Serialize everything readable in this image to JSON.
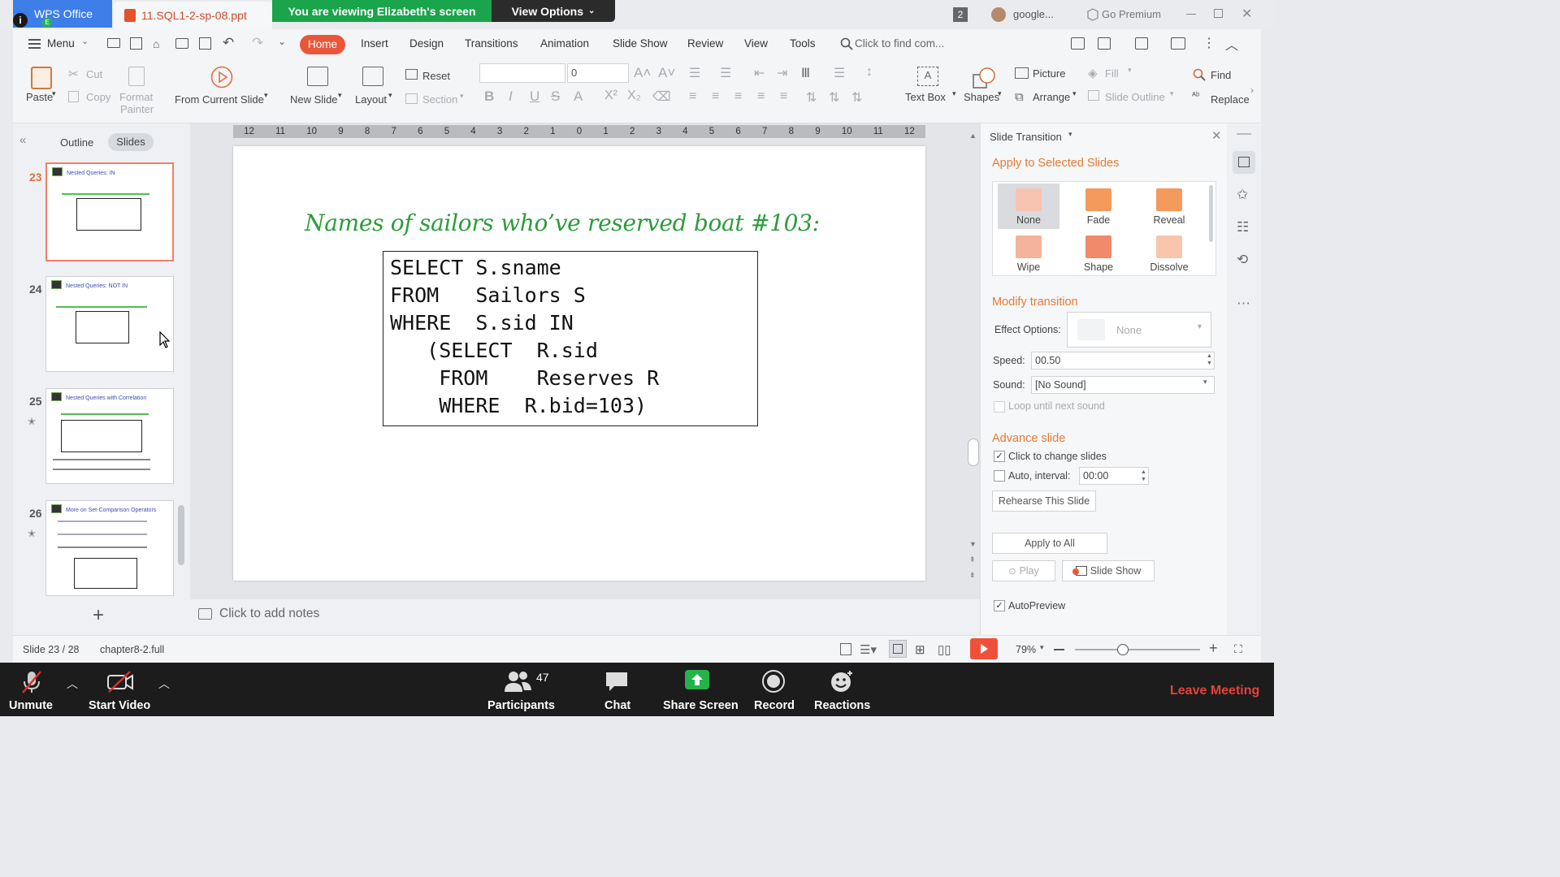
{
  "window": {
    "app_tab": "WPS Office",
    "file_tab": "11.SQL1-2-sp-08.ppt",
    "share_banner": "You are viewing Elizabeth's screen",
    "view_options": "View Options",
    "badge_count": "2",
    "account": "google...",
    "premium": "Go Premium"
  },
  "menubar": {
    "menu_label": "Menu",
    "tabs": [
      "Home",
      "Insert",
      "Design",
      "Transitions",
      "Animation",
      "Slide Show",
      "Review",
      "View",
      "Tools"
    ],
    "search_placeholder": "Click to find com..."
  },
  "ribbon": {
    "paste": "Paste",
    "cut": "Cut",
    "copy": "Copy",
    "format_painter_1": "Format",
    "format_painter_2": "Painter",
    "from_current_slide": "From Current Slide",
    "new_slide": "New Slide",
    "layout": "Layout",
    "reset": "Reset",
    "section": "Section",
    "font_size": "0",
    "text_box": "Text Box",
    "shapes": "Shapes",
    "picture": "Picture",
    "arrange": "Arrange",
    "fill": "Fill",
    "slide_outline": "Slide Outline",
    "find": "Find",
    "replace": "Replace"
  },
  "left_panel": {
    "outline_tab": "Outline",
    "slides_tab": "Slides",
    "thumbnails": [
      {
        "num": "23",
        "title": "Nested Queries: IN",
        "selected": true,
        "starred": false
      },
      {
        "num": "24",
        "title": "Nested Queries: NOT IN",
        "selected": false,
        "starred": false
      },
      {
        "num": "25",
        "title": "Nested Queries with Correlation",
        "selected": false,
        "starred": true
      },
      {
        "num": "26",
        "title": "More on Set-Comparison Operators",
        "selected": false,
        "starred": true
      }
    ]
  },
  "slide": {
    "ruler": [
      "12",
      "11",
      "10",
      "9",
      "8",
      "7",
      "6",
      "5",
      "4",
      "3",
      "2",
      "1",
      "0",
      "1",
      "2",
      "3",
      "4",
      "5",
      "6",
      "7",
      "8",
      "9",
      "10",
      "11",
      "12"
    ],
    "title": "Names of sailors who’ve reserved boat #103:",
    "code": [
      "SELECT S.sname",
      "FROM   Sailors S",
      "WHERE  S.sid IN",
      "   (SELECT  R.sid",
      "    FROM    Reserves R",
      "    WHERE  R.bid=103)"
    ]
  },
  "notes_placeholder": "Click to add notes",
  "transition_panel": {
    "header": "Slide Transition",
    "apply_selected": "Apply to Selected Slides",
    "effects": [
      {
        "label": "None",
        "color": "#f6c4b0"
      },
      {
        "label": "Fade",
        "color": "#f39a5c"
      },
      {
        "label": "Reveal",
        "color": "#f39a5c"
      },
      {
        "label": "Wipe",
        "color": "#f4b39a"
      },
      {
        "label": "Shape",
        "color": "#f08a6a"
      },
      {
        "label": "Dissolve",
        "color": "#f7c6ad"
      }
    ],
    "modify": "Modify transition",
    "effect_options_label": "Effect Options:",
    "effect_options_value": "None",
    "speed_label": "Speed:",
    "speed_value": "00.50",
    "sound_label": "Sound:",
    "sound_value": "[No Sound]",
    "loop": "Loop until next sound",
    "advance": "Advance slide",
    "click_change": "Click to change slides",
    "auto_interval": "Auto, interval:",
    "interval_value": "00:00",
    "rehearse": "Rehearse This Slide",
    "apply_all": "Apply to All",
    "play": "Play",
    "slide_show": "Slide Show",
    "autopreview": "AutoPreview"
  },
  "statusbar": {
    "slide_info": "Slide 23 / 28",
    "theme": "chapter8-2.full",
    "zoom": "79%"
  },
  "zoom_meeting": {
    "unmute": "Unmute",
    "start_video": "Start Video",
    "participants": "Participants",
    "participant_count": "47",
    "chat": "Chat",
    "share_screen": "Share Screen",
    "record": "Record",
    "reactions": "Reactions",
    "leave": "Leave Meeting"
  }
}
